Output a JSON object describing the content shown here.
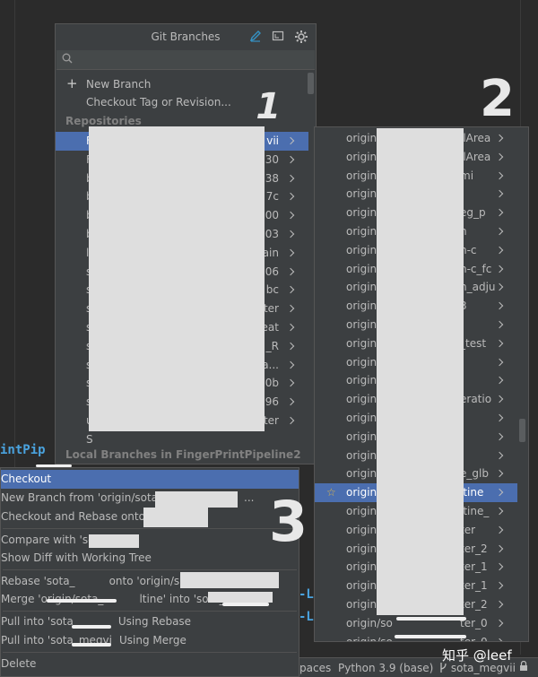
{
  "popup": {
    "title": "Git Branches",
    "header_icons": [
      "pencil-icon",
      "fullscreen-icon",
      "gear-icon"
    ],
    "search_placeholder": "",
    "actions": [
      "New Branch",
      "Checkout Tag or Revision..."
    ],
    "repositories_label": "Repositories",
    "repo_rows": [
      {
        "lead": "F",
        "tail": "vii"
      },
      {
        "lead": "F",
        "tail": "30"
      },
      {
        "lead": "b",
        "tail": "38"
      },
      {
        "lead": "b",
        "tail": "7c"
      },
      {
        "lead": "b",
        "tail": "00"
      },
      {
        "lead": "b",
        "tail": "03"
      },
      {
        "lead": "li",
        "tail": "ain"
      },
      {
        "lead": "s",
        "tail": "06"
      },
      {
        "lead": "s",
        "tail": "bc"
      },
      {
        "lead": "s",
        "tail": "ter"
      },
      {
        "lead": "s",
        "tail": "eat"
      },
      {
        "lead": "s",
        "tail": "_R"
      },
      {
        "lead": "s",
        "tail": "a..."
      },
      {
        "lead": "s",
        "tail": "0b"
      },
      {
        "lead": "s",
        "tail": "96"
      },
      {
        "lead": "u",
        "tail": "ter"
      },
      {
        "lead": "S",
        "tail": ""
      }
    ],
    "local_branches_label": "Local Branches in FingerPrintPipeline2"
  },
  "submenu": {
    "rows": [
      {
        "prefix": "origin",
        "suffix": "llArea"
      },
      {
        "prefix": "origin",
        "suffix": "llArea"
      },
      {
        "prefix": "origin",
        "suffix": "mi"
      },
      {
        "prefix": "origin",
        "suffix": ""
      },
      {
        "prefix": "origin",
        "suffix": "eg_p"
      },
      {
        "prefix": "origin",
        "suffix": "n"
      },
      {
        "prefix": "origin",
        "suffix": "n-c"
      },
      {
        "prefix": "origin",
        "suffix": "n-c_fc"
      },
      {
        "prefix": "origin",
        "suffix": "n_adju"
      },
      {
        "prefix": "origin",
        "suffix": "3"
      },
      {
        "prefix": "origin",
        "suffix": ""
      },
      {
        "prefix": "origin",
        "suffix": "_test"
      },
      {
        "prefix": "origin",
        "suffix": ""
      },
      {
        "prefix": "origin",
        "suffix": ""
      },
      {
        "prefix": "origin",
        "suffix": "eratio"
      },
      {
        "prefix": "origin",
        "suffix": ""
      },
      {
        "prefix": "origin",
        "suffix": ""
      },
      {
        "prefix": "origin",
        "suffix": ""
      },
      {
        "prefix": "origin",
        "suffix": "e_glb"
      },
      {
        "prefix": "origin",
        "suffix": "ltine"
      },
      {
        "prefix": "origin",
        "suffix": "ltine_"
      },
      {
        "prefix": "origin",
        "suffix": "ter"
      },
      {
        "prefix": "origin",
        "suffix": "ter_2"
      },
      {
        "prefix": "origin",
        "suffix": "ter_1"
      },
      {
        "prefix": "origin",
        "suffix": "ter_1"
      },
      {
        "prefix": "origin",
        "suffix": "ter_2"
      },
      {
        "prefix": "origin/so",
        "suffix": "ter_0"
      },
      {
        "prefix": "origin/so",
        "suffix": "ter_0"
      }
    ]
  },
  "context_menu": {
    "checkout": "Checkout",
    "new_branch": "New Branch from 'origin/sota",
    "new_branch_tail": "...",
    "checkout_rebase": "Checkout and Rebase onto",
    "compare": "Compare with 'sc",
    "show_diff": "Show Diff with Working Tree",
    "rebase_a": "Rebase 'sota_",
    "rebase_b": "onto 'origin/s",
    "rebase_c": "'",
    "merge_a": "Merge 'origin/sota_",
    "merge_b": "ltine' into 'sota_",
    "pull_rebase_a": "Pull into 'sota_",
    "pull_rebase_b": "Using Rebase",
    "pull_merge_a": "Pull into 'sota_megvi",
    "pull_merge_b": "Using Merge",
    "delete": "Delete"
  },
  "editor": {
    "frag_left": "intPip",
    "frag_right_1": "-Li",
    "frag_right_2": "-Li"
  },
  "status_bar": {
    "spaces": "paces",
    "python": "Python 3.9 (base)",
    "branch": "sota_megvii"
  },
  "annotations": {
    "one": "1",
    "two": "2",
    "three": "3",
    "watermark": "知乎 @leef"
  }
}
